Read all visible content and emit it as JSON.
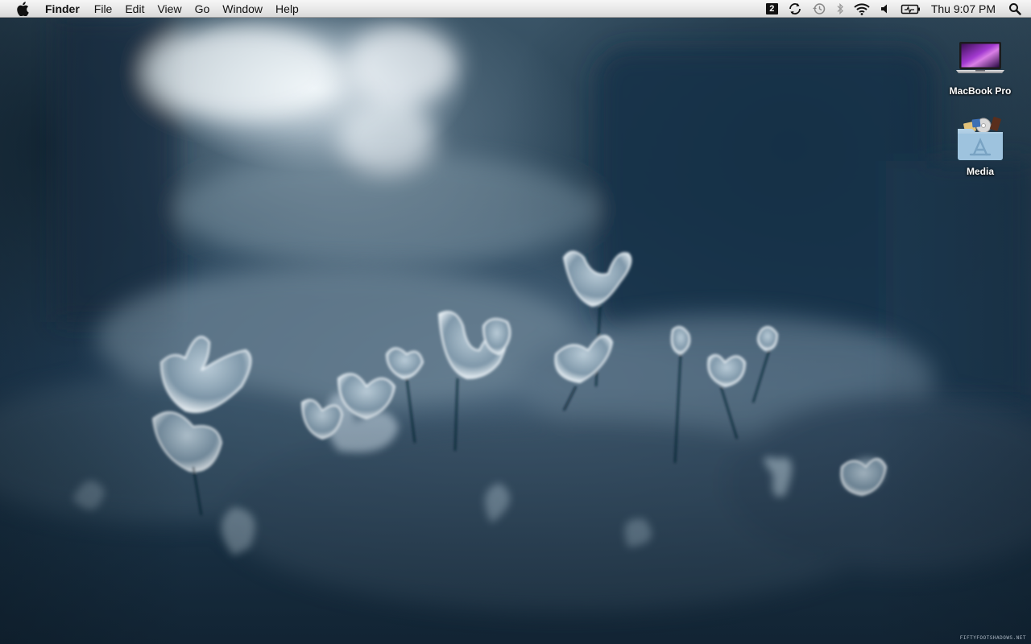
{
  "menubar": {
    "apple_icon": "apple-logo-icon",
    "app_name": "Finder",
    "menus": [
      "File",
      "Edit",
      "View",
      "Go",
      "Window",
      "Help"
    ],
    "status": {
      "spaces_number": "2",
      "icons": [
        "spaces-icon",
        "sync-icon",
        "time-machine-icon",
        "bluetooth-icon",
        "wifi-icon",
        "volume-icon",
        "battery-icon",
        "spotlight-search-icon"
      ],
      "clock": "Thu 9:07 PM"
    }
  },
  "desktop": {
    "icons": [
      {
        "label": "MacBook Pro",
        "icon": "macbook-pro-icon"
      },
      {
        "label": "Media",
        "icon": "applications-folder-icon"
      }
    ],
    "wallpaper_credit": "FIFTYFOOTSHADOWS.NET"
  },
  "colors": {
    "menubar_top": "#f6f6f6",
    "menubar_bottom": "#d9d9d9",
    "wallpaper_dark": "#1a3145",
    "wallpaper_mid": "#2b465a",
    "frost_highlight": "#e6eef3",
    "folder_blue": "#8fb7d6"
  }
}
